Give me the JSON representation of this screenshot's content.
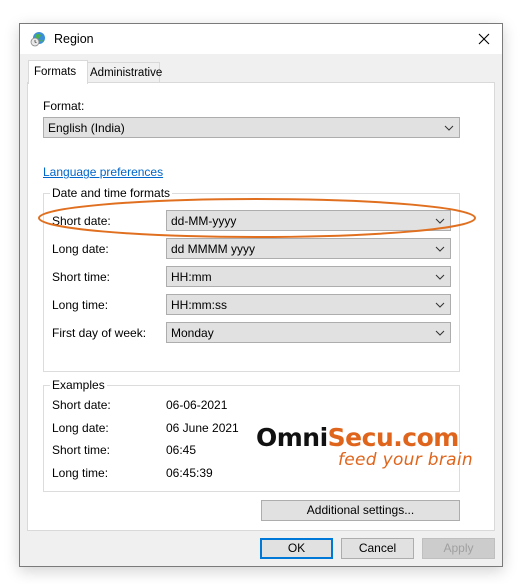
{
  "window": {
    "title": "Region",
    "icon": "globe-clock-icon",
    "close_icon": "close-icon"
  },
  "tabs": [
    {
      "label": "Formats",
      "active": true
    },
    {
      "label": "Administrative",
      "active": false
    }
  ],
  "format": {
    "label": "Format:",
    "value": "English (India)"
  },
  "language_preferences_link": "Language preferences",
  "date_time_formats": {
    "title": "Date and time formats",
    "rows": [
      {
        "label": "Short date:",
        "value": "dd-MM-yyyy",
        "highlighted": true
      },
      {
        "label": "Long date:",
        "value": "dd MMMM yyyy"
      },
      {
        "label": "Short time:",
        "value": "HH:mm"
      },
      {
        "label": "Long time:",
        "value": "HH:mm:ss"
      },
      {
        "label": "First day of week:",
        "value": "Monday"
      }
    ]
  },
  "examples": {
    "title": "Examples",
    "rows": [
      {
        "label": "Short date:",
        "value": "06-06-2021"
      },
      {
        "label": "Long date:",
        "value": "06 June 2021"
      },
      {
        "label": "Short time:",
        "value": "06:45"
      },
      {
        "label": "Long time:",
        "value": "06:45:39"
      }
    ]
  },
  "additional_settings_label": "Additional settings...",
  "buttons": {
    "ok": "OK",
    "cancel": "Cancel",
    "apply": "Apply"
  },
  "watermark": {
    "brand_part1": "Omni",
    "brand_part2": "Secu.com",
    "tagline": "feed your brain"
  },
  "colors": {
    "highlight_ellipse": "#e07020",
    "link": "#0066cc",
    "default_button_border": "#0078d7"
  }
}
